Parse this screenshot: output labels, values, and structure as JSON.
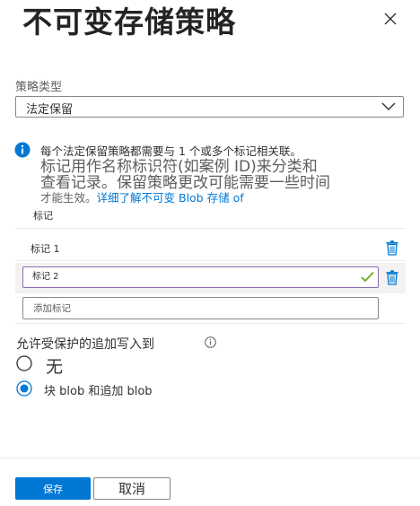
{
  "header": {
    "title": "不可变存储策略",
    "close_icon": "close-icon"
  },
  "policy_type": {
    "label": "策略类型",
    "selected": "法定保留"
  },
  "info": {
    "icon": "info-icon",
    "line1": "每个法定保留策略都需要与 1 个或多个标记相关联。",
    "line2": "标记用作名称标识符(如案例 ID)来分类和",
    "line3": "查看记录。保留策略更改可能需要一些时间",
    "line4_text": "才能生效。",
    "line4_link": "详细了解不可变 Blob 存储 of"
  },
  "tags": {
    "header": "标记",
    "rows": [
      {
        "value": "标记 1",
        "state": "saved"
      },
      {
        "value": "标记 2",
        "state": "editing-valid"
      }
    ],
    "add_placeholder": "添加标记"
  },
  "append_writes": {
    "label": "允许受保护的追加写入到",
    "options": [
      {
        "label": "无",
        "selected": false
      },
      {
        "label": "块 blob 和追加 blob",
        "selected": true
      }
    ]
  },
  "footer": {
    "save_label": "保存",
    "cancel_label": "取消"
  },
  "colors": {
    "accent": "#0078d4",
    "valid_check": "#57a300",
    "editing_border": "#8a6bb0"
  }
}
